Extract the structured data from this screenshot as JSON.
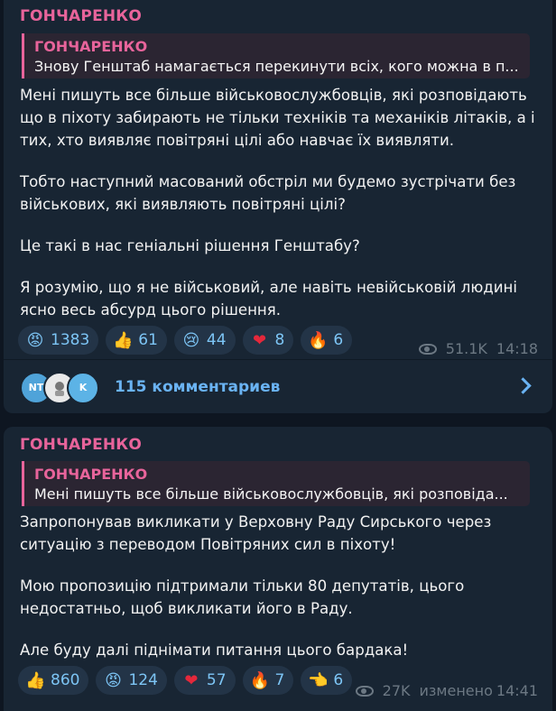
{
  "posts": [
    {
      "author": "ГОНЧАРЕНКО",
      "reply": {
        "author": "ГОНЧАРЕНКО",
        "text": "Знову Генштаб намагається перекинути всіх, кого можна в п..."
      },
      "paragraphs": [
        "Мені пишуть все більше військовослужбовців, які розповідають що в піхоту забирають не тільки техніків та механіків літаків, а і тих, хто виявляє повітряні цілі або навчає їх виявляти.",
        "Тобто наступний масований обстріл ми будемо зустрічати без військових, які виявляють повітряні цілі?",
        "Це такі в нас геніальні рішення Генштабу?",
        "Я розумію, що я не військовий, але навіть невійськовій людині ясно весь абсурд цього рішення."
      ],
      "reactions": [
        {
          "icon": "angry-face",
          "glyph": "😡",
          "count": "1383"
        },
        {
          "icon": "thumbs-up",
          "glyph": "👍",
          "count": "61"
        },
        {
          "icon": "crying-face",
          "glyph": "😢",
          "count": "44"
        },
        {
          "icon": "heart",
          "glyph": "❤",
          "count": "8"
        },
        {
          "icon": "fire",
          "glyph": "🔥",
          "count": "6"
        }
      ],
      "views": "51.1K",
      "time": "14:18",
      "comments": {
        "avatars": [
          "NT",
          "",
          "K"
        ],
        "label": "115 комментариев"
      }
    },
    {
      "author": "ГОНЧАРЕНКО",
      "reply": {
        "author": "ГОНЧАРЕНКО",
        "text": "Мені пишуть все більше військовослужбовців, які розповіда..."
      },
      "paragraphs": [
        "Запропонував викликати у Верховну Раду Сирського через ситуацію з переводом Повітряних сил в піхоту!",
        "Мою пропозицію підтримали тільки 80 депутатів, цього недостатньо, щоб викликати його в Раду.",
        "Але буду далі піднімати питання цього бардака!"
      ],
      "reactions": [
        {
          "icon": "thumbs-up",
          "glyph": "👍",
          "count": "860"
        },
        {
          "icon": "angry-face",
          "glyph": "😡",
          "count": "124"
        },
        {
          "icon": "heart",
          "glyph": "❤",
          "count": "57"
        },
        {
          "icon": "fire",
          "glyph": "🔥",
          "count": "7"
        },
        {
          "icon": "pointing-hand",
          "glyph": "👈",
          "count": "6"
        }
      ],
      "views": "27K",
      "edited": "изменено",
      "time": "14:41"
    }
  ],
  "colors": {
    "background": "#0e1621",
    "bubble": "#182533",
    "accent": "#e8649b",
    "link": "#6ab3f3"
  }
}
